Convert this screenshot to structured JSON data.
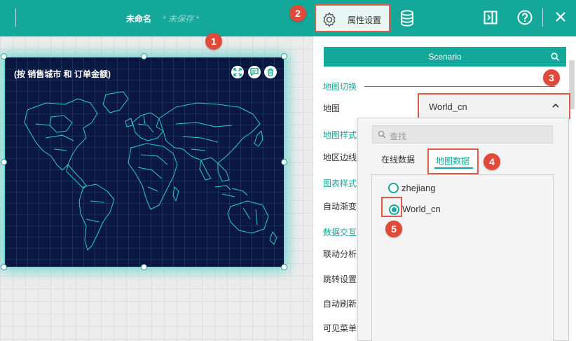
{
  "header": {
    "doc_title": "未命名",
    "doc_status": "* 未保存 *",
    "tabs": [
      {
        "label": "属性设置",
        "icon": "gear-icon",
        "active": true
      },
      {
        "label": "",
        "icon": "database-icon",
        "active": false
      }
    ],
    "right_icons": [
      "panel-toggle-icon",
      "help-icon",
      "close-icon"
    ]
  },
  "widget": {
    "title": "(按 销售城市 和 订单金额)",
    "toolbar_icons": [
      "fullscreen-icon",
      "comment-icon",
      "delete-icon"
    ],
    "map_theme_color": "#0a1740"
  },
  "panel": {
    "scenario_label": "Scenario",
    "sections": {
      "map_switch": "地图切换",
      "map_style": "地图样式",
      "chart_style": "图表样式",
      "data_interaction": "数据交互"
    },
    "rows": {
      "map": "地图",
      "region_border": "地区边线",
      "auto_gradient": "自动渐变",
      "linked_analysis": "联动分析",
      "jump_settings": "跳转设置",
      "auto_refresh": "自动刷新",
      "visible_menu": "可见菜单"
    },
    "map_select_value": "World_cn"
  },
  "dropdown": {
    "search_placeholder": "查找",
    "tabs": [
      {
        "label": "在线数据",
        "active": false
      },
      {
        "label": "地图数据",
        "active": true
      }
    ],
    "options": [
      {
        "label": "zhejiang",
        "selected": false
      },
      {
        "label": "World_cn",
        "selected": true
      }
    ]
  },
  "annotations": [
    "1",
    "2",
    "3",
    "4",
    "5"
  ],
  "colors": {
    "accent": "#14a89a",
    "highlight": "#e15a4a",
    "badge": "#e04a3a"
  }
}
